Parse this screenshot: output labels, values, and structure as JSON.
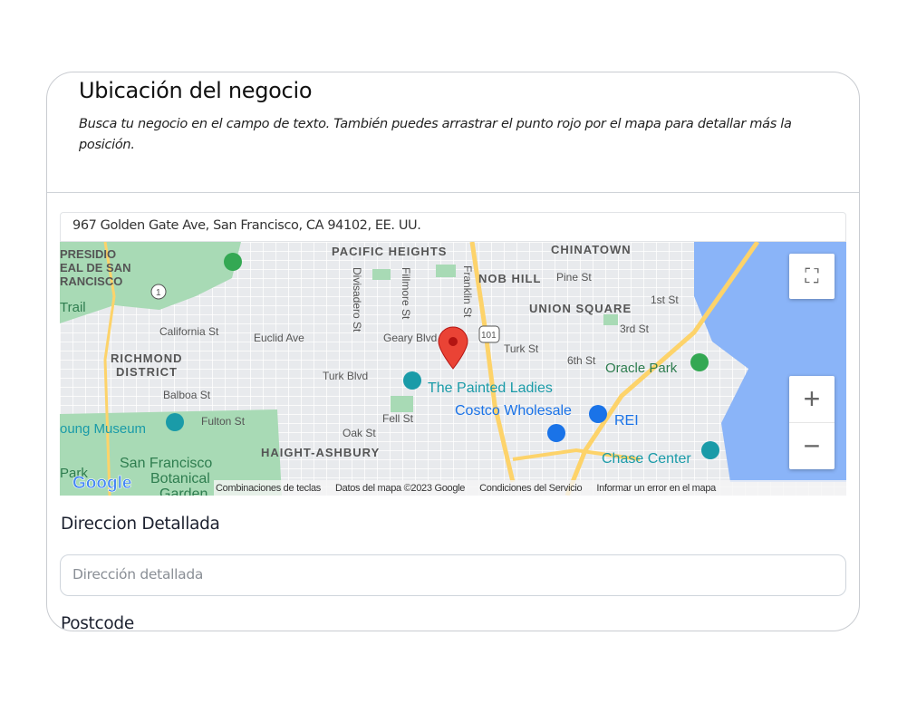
{
  "section": {
    "title": "Ubicación del negocio",
    "description": "Busca tu negocio en el campo de texto. También puedes arrastrar el punto rojo por el mapa para detallar más la posición."
  },
  "search": {
    "value": "967 Golden Gate Ave, San Francisco, CA 94102, EE. UU."
  },
  "map": {
    "labels": [
      "PACIFIC HEIGHTS",
      "CHINATOWN",
      "PRESIDIO",
      "EAL DE SAN",
      "RANCISCO",
      "NOB HILL",
      "Pine St",
      "UNION SQUARE",
      "1st St",
      "Trail",
      "California St",
      "Euclid Ave",
      "Geary Blvd",
      "Turk St",
      "3rd St",
      "RICHMOND",
      "DISTRICT",
      "Turk Blvd",
      "6th St",
      "Oracle Park",
      "Balboa St",
      "The Painted Ladies",
      "Costco Wholesale",
      "REI",
      "oung Museum",
      "Fulton St",
      "Fell St",
      "Oak St",
      "HAIGHT-ASHBURY",
      "Chase Center",
      "San Francisco",
      "Botanical",
      "Garden",
      "Park",
      "Divisadero St",
      "Fillmore St",
      "Franklin St",
      "1",
      "101"
    ],
    "logo": "Google",
    "attribution": [
      "Combinaciones de teclas",
      "Datos del mapa ©2023 Google",
      "Condiciones del Servicio",
      "Informar un error en el mapa"
    ],
    "colors": {
      "park": "#a8dab5",
      "water": "#8ab4f8",
      "highway": "#fdd36a",
      "pin": "#ea4335",
      "poi": "#1a9ba8"
    }
  },
  "fields": {
    "detail_label": "Direccion Detallada",
    "detail_placeholder": "Dirección detallada",
    "postcode_label": "Postcode"
  }
}
